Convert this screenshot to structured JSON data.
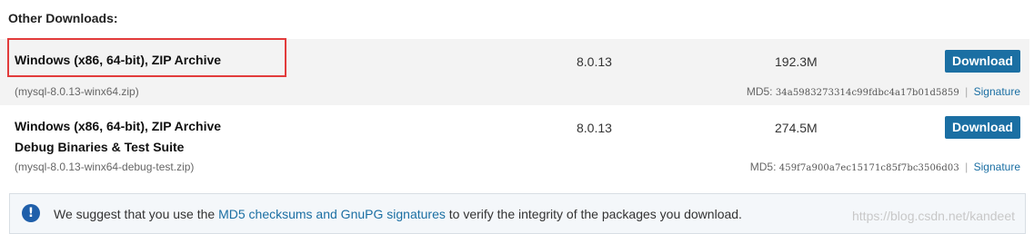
{
  "section_title": "Other Downloads:",
  "rows": [
    {
      "name_line1": "Windows (x86, 64-bit), ZIP Archive",
      "name_line2": "",
      "file": "(mysql-8.0.13-winx64.zip)",
      "version": "8.0.13",
      "size": "192.3M",
      "button_label": "Download",
      "md5_label": "MD5:",
      "md5_value": "34a5983273314c99fdbc4a17b01d5859",
      "signature_label": "Signature",
      "highlighted": true
    },
    {
      "name_line1": "Windows (x86, 64-bit), ZIP Archive",
      "name_line2": "Debug Binaries & Test Suite",
      "file": "(mysql-8.0.13-winx64-debug-test.zip)",
      "version": "8.0.13",
      "size": "274.5M",
      "button_label": "Download",
      "md5_label": "MD5:",
      "md5_value": "459f7a900a7ec15171c85f7bc3506d03",
      "signature_label": "Signature",
      "highlighted": false
    }
  ],
  "notice": {
    "icon": "info-icon",
    "text_before": "We suggest that you use the ",
    "link_text": "MD5 checksums and GnuPG signatures",
    "text_after": " to verify the integrity of the packages you download.",
    "watermark": "https://blog.csdn.net/kandeet"
  },
  "colors": {
    "button_bg": "#1b6fa3",
    "link": "#1b6fa3",
    "highlight_border": "#e23b3b",
    "row_alt_bg": "#f3f3f3"
  }
}
